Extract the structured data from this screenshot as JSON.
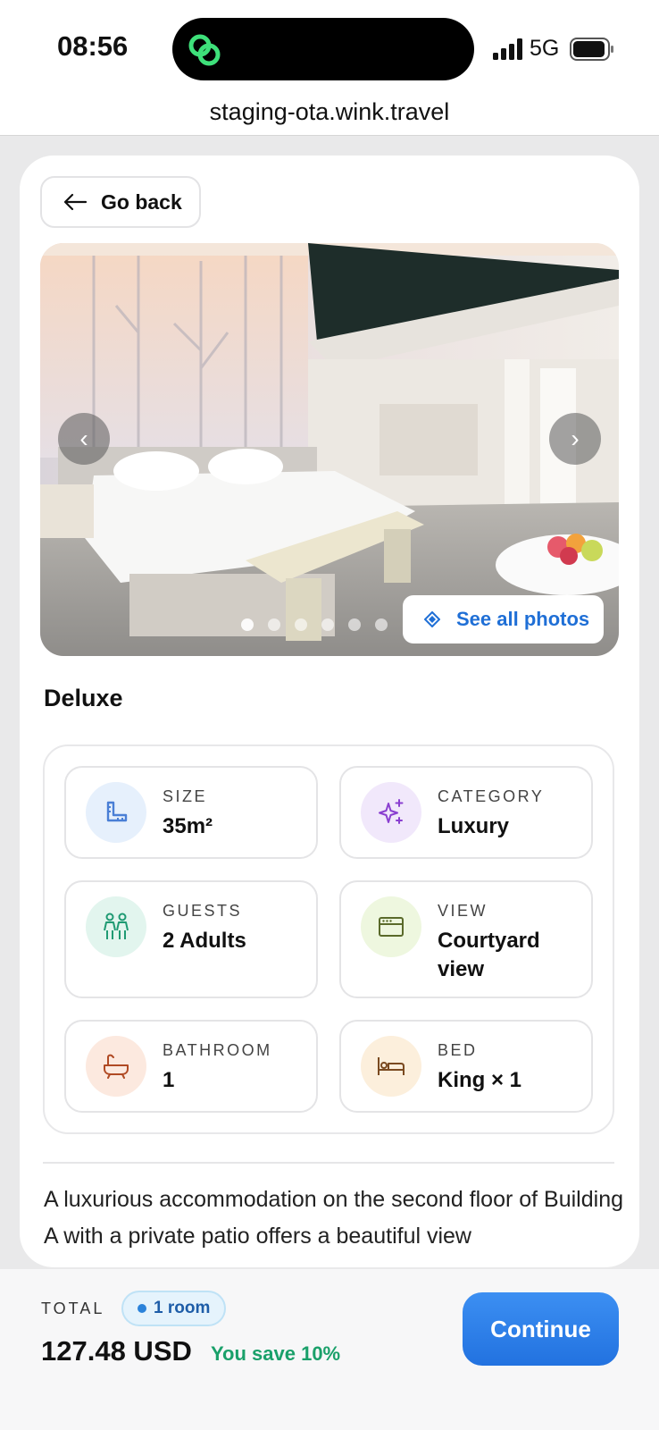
{
  "status_bar": {
    "time": "08:56",
    "network": "5G",
    "island_logo": "link-icon"
  },
  "browser": {
    "url": "staging-ota.wink.travel"
  },
  "back": {
    "label": "Go back",
    "icon": "arrow-left-icon"
  },
  "gallery": {
    "dots": 6,
    "active_dot": 0,
    "see_all_label": "See all photos",
    "see_all_icon": "diamond-icon",
    "prev_glyph": "‹",
    "next_glyph": "›"
  },
  "room": {
    "title": "Deluxe",
    "features": [
      {
        "label": "SIZE",
        "value": "35m²",
        "icon": "ruler-icon",
        "color": "#4a7fd6",
        "bg": "#e6f0fc"
      },
      {
        "label": "CATEGORY",
        "value": "Luxury",
        "icon": "sparkles-icon",
        "color": "#8a3fd0",
        "bg": "#f1e8fb"
      },
      {
        "label": "GUESTS",
        "value": "2 Adults",
        "icon": "people-icon",
        "color": "#1f9a73",
        "bg": "#e2f5ee"
      },
      {
        "label": "VIEW",
        "value": "Courtyard view",
        "icon": "window-icon",
        "color": "#5a8a2a",
        "bg": "#eef7df"
      },
      {
        "label": "BATHROOM",
        "value": "1",
        "icon": "bathtub-icon",
        "color": "#c0562b",
        "bg": "#fce9df"
      },
      {
        "label": "BED",
        "value": "King × 1",
        "icon": "bed-icon",
        "color": "#b06e2a",
        "bg": "#fcefdc"
      }
    ],
    "description": "A luxurious accommodation on the second floor of Building A with a private patio offers a beautiful view"
  },
  "footer": {
    "total_label": "TOTAL",
    "rooms_badge": "1 room",
    "total_value": "127.48 USD",
    "savings": "You save 10%",
    "continue_label": "Continue"
  },
  "colors": {
    "accent": "#2a7de6",
    "savings": "#1aa06a",
    "island_logo": "#3ee07a"
  }
}
